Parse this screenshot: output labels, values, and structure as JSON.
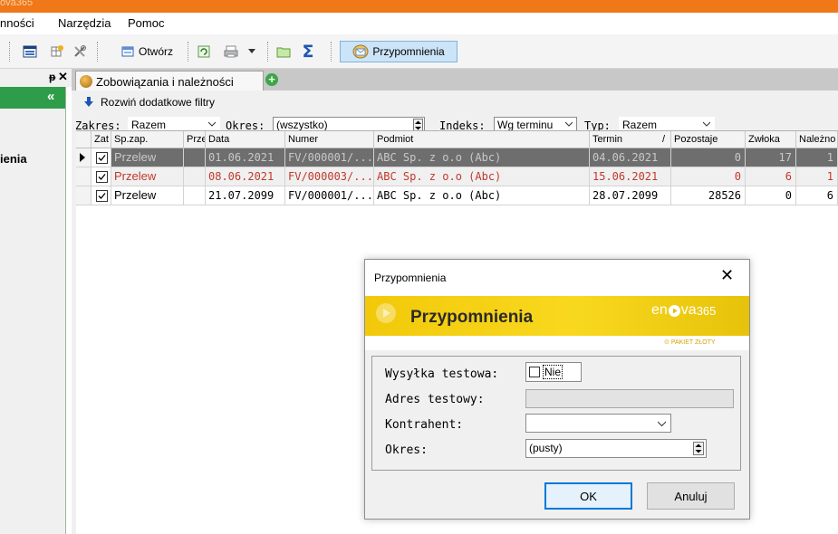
{
  "app": {
    "title_fragment": "ova365"
  },
  "menu": {
    "items": [
      "nności",
      "Narzędzia",
      "Pomoc"
    ]
  },
  "toolbar": {
    "open_label": "Otwórz",
    "reminders_label": "Przypomnienia"
  },
  "left_panel": {
    "pin_glyph": "†",
    "close_glyph": "✕",
    "collapse_glyph": "«",
    "section_label": "ienia"
  },
  "tab": {
    "label": "Zobowiązania i należności"
  },
  "filters": {
    "expand_label": "Rozwiń dodatkowe filtry",
    "zakres_label": "Zakres:",
    "zakres_value": "Razem",
    "okres_label": "Okres:",
    "okres_value": "(wszystko)",
    "indeks_label": "Indeks:",
    "indeks_value": "Wg terminu",
    "typ_label": "Typ:",
    "typ_value": "Razem"
  },
  "grid": {
    "columns": [
      "Zat",
      "Sp.zap.",
      "Prze",
      "Data",
      "Numer",
      "Podmiot",
      "Termin",
      "Pozostaje",
      "Zwłoka",
      "Należno"
    ],
    "rows": [
      {
        "sp": "Przelew",
        "data": "01.06.2021",
        "numer": "FV/000001/...",
        "podmiot": "ABC Sp. z o.o (Abc)",
        "termin": "04.06.2021",
        "pozostaje": "0",
        "zwloka": "17",
        "naleznosc": "1"
      },
      {
        "sp": "Przelew",
        "data": "08.06.2021",
        "numer": "FV/000003/...",
        "podmiot": "ABC Sp. z o.o (Abc)",
        "termin": "15.06.2021",
        "pozostaje": "0",
        "zwloka": "6",
        "naleznosc": "1"
      },
      {
        "sp": "Przelew",
        "data": "21.07.2099",
        "numer": "FV/000001/...",
        "podmiot": "ABC Sp. z o.o (Abc)",
        "termin": "28.07.2099",
        "pozostaje": "28526",
        "zwloka": "0",
        "naleznosc": "6"
      }
    ]
  },
  "dialog": {
    "title": "Przypomnienia",
    "banner_title": "Przypomnienia",
    "brand_prefix": "en",
    "brand_suffix": "va",
    "brand_num": "365",
    "package_label": "PAKIET ZŁOTY",
    "wysylka_label": "Wysyłka testowa:",
    "wysylka_value": "Nie",
    "adres_label": "Adres testowy:",
    "kontrahent_label": "Kontrahent:",
    "okres_label": "Okres:",
    "okres_value": "(pusty)",
    "ok_label": "OK",
    "cancel_label": "Anuluj"
  },
  "colors": {
    "accent_orange": "#f07818",
    "overdue_red": "#c0392b",
    "selected_row": "#6e6e6e",
    "left_green": "#2e9d4a",
    "banner_yellow": "#f4cd12"
  }
}
